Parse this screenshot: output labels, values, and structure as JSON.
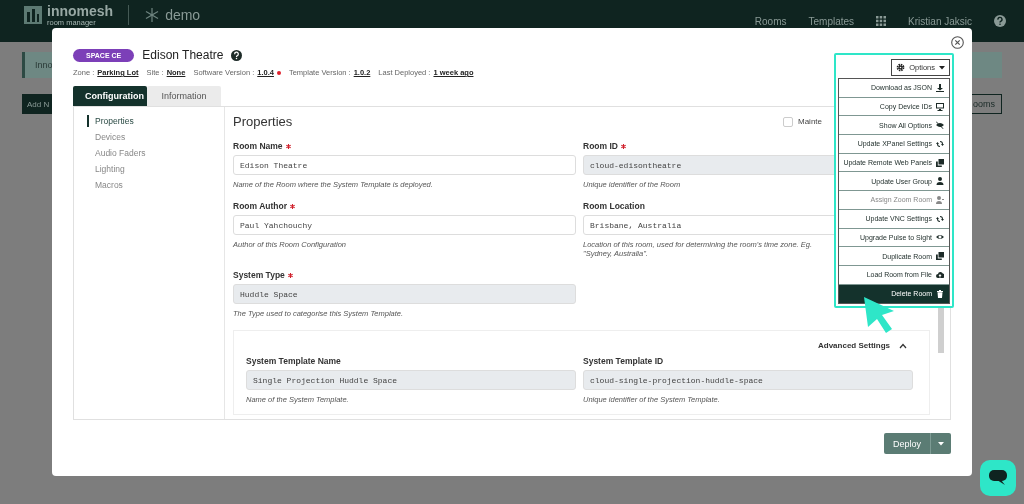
{
  "header": {
    "logo_name": "innomesh",
    "logo_sub": "room manager",
    "tenant": "demo",
    "nav": [
      {
        "label": "Rooms"
      },
      {
        "label": "Templates"
      }
    ],
    "user": "Kristian Jaksic"
  },
  "backdrop": {
    "alert": "Inno",
    "add_button": "Add N",
    "right_button": "ooms"
  },
  "modal": {
    "badge": "SPACE CE",
    "title": "Edison Theatre",
    "meta": [
      {
        "label": "Zone :",
        "value": "Parking Lot",
        "alert": false
      },
      {
        "label": "Site :",
        "value": "None",
        "alert": false
      },
      {
        "label": "Software Version :",
        "value": "1.0.4",
        "alert": true
      },
      {
        "label": "Template Version :",
        "value": "1.0.2",
        "alert": false
      },
      {
        "label": "Last Deployed :",
        "value": "1 week ago",
        "alert": false
      }
    ],
    "tabs": [
      {
        "label": "Configuration",
        "selected": true
      },
      {
        "label": "Information",
        "selected": false
      }
    ],
    "sidebar": [
      {
        "label": "Properties",
        "selected": true
      },
      {
        "label": "Devices",
        "selected": false
      },
      {
        "label": "Audio Faders",
        "selected": false
      },
      {
        "label": "Lighting",
        "selected": false
      },
      {
        "label": "Macros",
        "selected": false
      }
    ],
    "heading": "Properties",
    "maintenance": {
      "label": "Mainte",
      "checked": false
    },
    "fields": [
      {
        "label": "Room Name",
        "required": true,
        "value": "Edison Theatre",
        "readonly": false,
        "hint": "Name of the Room where the System Template is deployed."
      },
      {
        "label": "Room ID",
        "required": true,
        "value": "cloud-edisontheatre",
        "readonly": true,
        "hint": "Unique identifier of the Room"
      },
      {
        "label": "Room Author",
        "required": true,
        "value": "Paul Yahchouchy",
        "readonly": false,
        "hint": "Author of this Room Configuration"
      },
      {
        "label": "Room Location",
        "required": false,
        "value": "Brisbane, Australia",
        "readonly": false,
        "hint": "Location of this room, used for determining the room's time zone. Eg. \"Sydney, Australia\"."
      },
      {
        "label": "System Type",
        "required": true,
        "value": "Huddle Space",
        "readonly": true,
        "hint": "The Type used to categorise this System Template."
      }
    ],
    "advanced": {
      "title": "Advanced Settings",
      "expanded": true,
      "fields": [
        {
          "label": "System Template Name",
          "value": "Single Projection Huddle Space",
          "readonly": true,
          "hint": "Name of the System Template."
        },
        {
          "label": "System Template ID",
          "value": "cloud-single-projection-huddle-space",
          "readonly": true,
          "hint": "Unique identifier of the System Template."
        }
      ]
    },
    "options": {
      "label": "Options",
      "expanded": true,
      "items": [
        {
          "label": "Download as JSON",
          "kind": "normal",
          "disabled": false
        },
        {
          "label": "Copy Device IDs",
          "kind": "normal",
          "disabled": false
        },
        {
          "label": "Show All Options",
          "kind": "normal",
          "disabled": false
        },
        {
          "label": "Update XPanel Settings",
          "kind": "normal",
          "disabled": false
        },
        {
          "label": "Update Remote Web Panels",
          "kind": "normal",
          "disabled": false
        },
        {
          "label": "Update User Group",
          "kind": "normal",
          "disabled": false
        },
        {
          "label": "Assign Zoom Room",
          "kind": "normal",
          "disabled": true
        },
        {
          "label": "Update VNC Settings",
          "kind": "normal",
          "disabled": false
        },
        {
          "label": "Upgrade Pulse to Sight",
          "kind": "normal",
          "disabled": false
        },
        {
          "label": "Duplicate Room",
          "kind": "normal",
          "disabled": false
        },
        {
          "label": "Load Room from File",
          "kind": "normal",
          "disabled": false
        },
        {
          "label": "Delete Room",
          "kind": "danger",
          "disabled": false
        }
      ]
    },
    "deploy": "Deploy"
  }
}
